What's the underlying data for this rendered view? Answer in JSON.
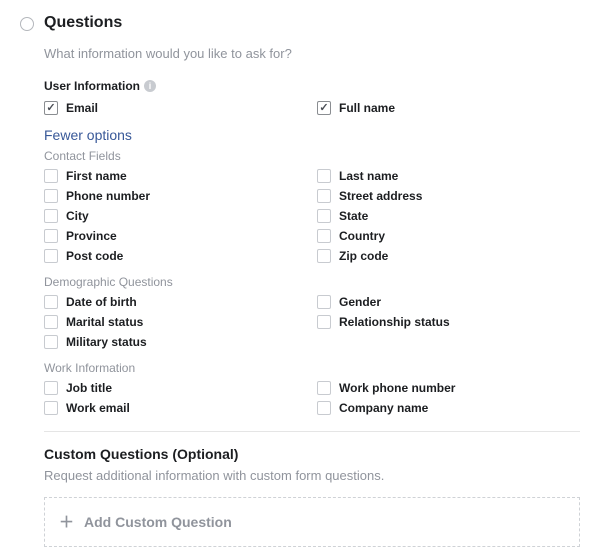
{
  "header": {
    "title": "Questions",
    "subtitle": "What information would you like to ask for?"
  },
  "user_info": {
    "label": "User Information",
    "fewer_options": "Fewer options",
    "top": {
      "left": "Email",
      "right": "Full name"
    },
    "contact": {
      "label": "Contact Fields",
      "left": [
        "First name",
        "Phone number",
        "City",
        "Province",
        "Post code"
      ],
      "right": [
        "Last name",
        "Street address",
        "State",
        "Country",
        "Zip code"
      ]
    },
    "demo": {
      "label": "Demographic Questions",
      "left": [
        "Date of birth",
        "Marital status",
        "Military status"
      ],
      "right": [
        "Gender",
        "Relationship status"
      ]
    },
    "work": {
      "label": "Work Information",
      "left": [
        "Job title",
        "Work email"
      ],
      "right": [
        "Work phone number",
        "Company name"
      ]
    }
  },
  "custom": {
    "title": "Custom Questions (Optional)",
    "subtitle": "Request additional information with custom form questions.",
    "add_label": "Add Custom Question"
  }
}
